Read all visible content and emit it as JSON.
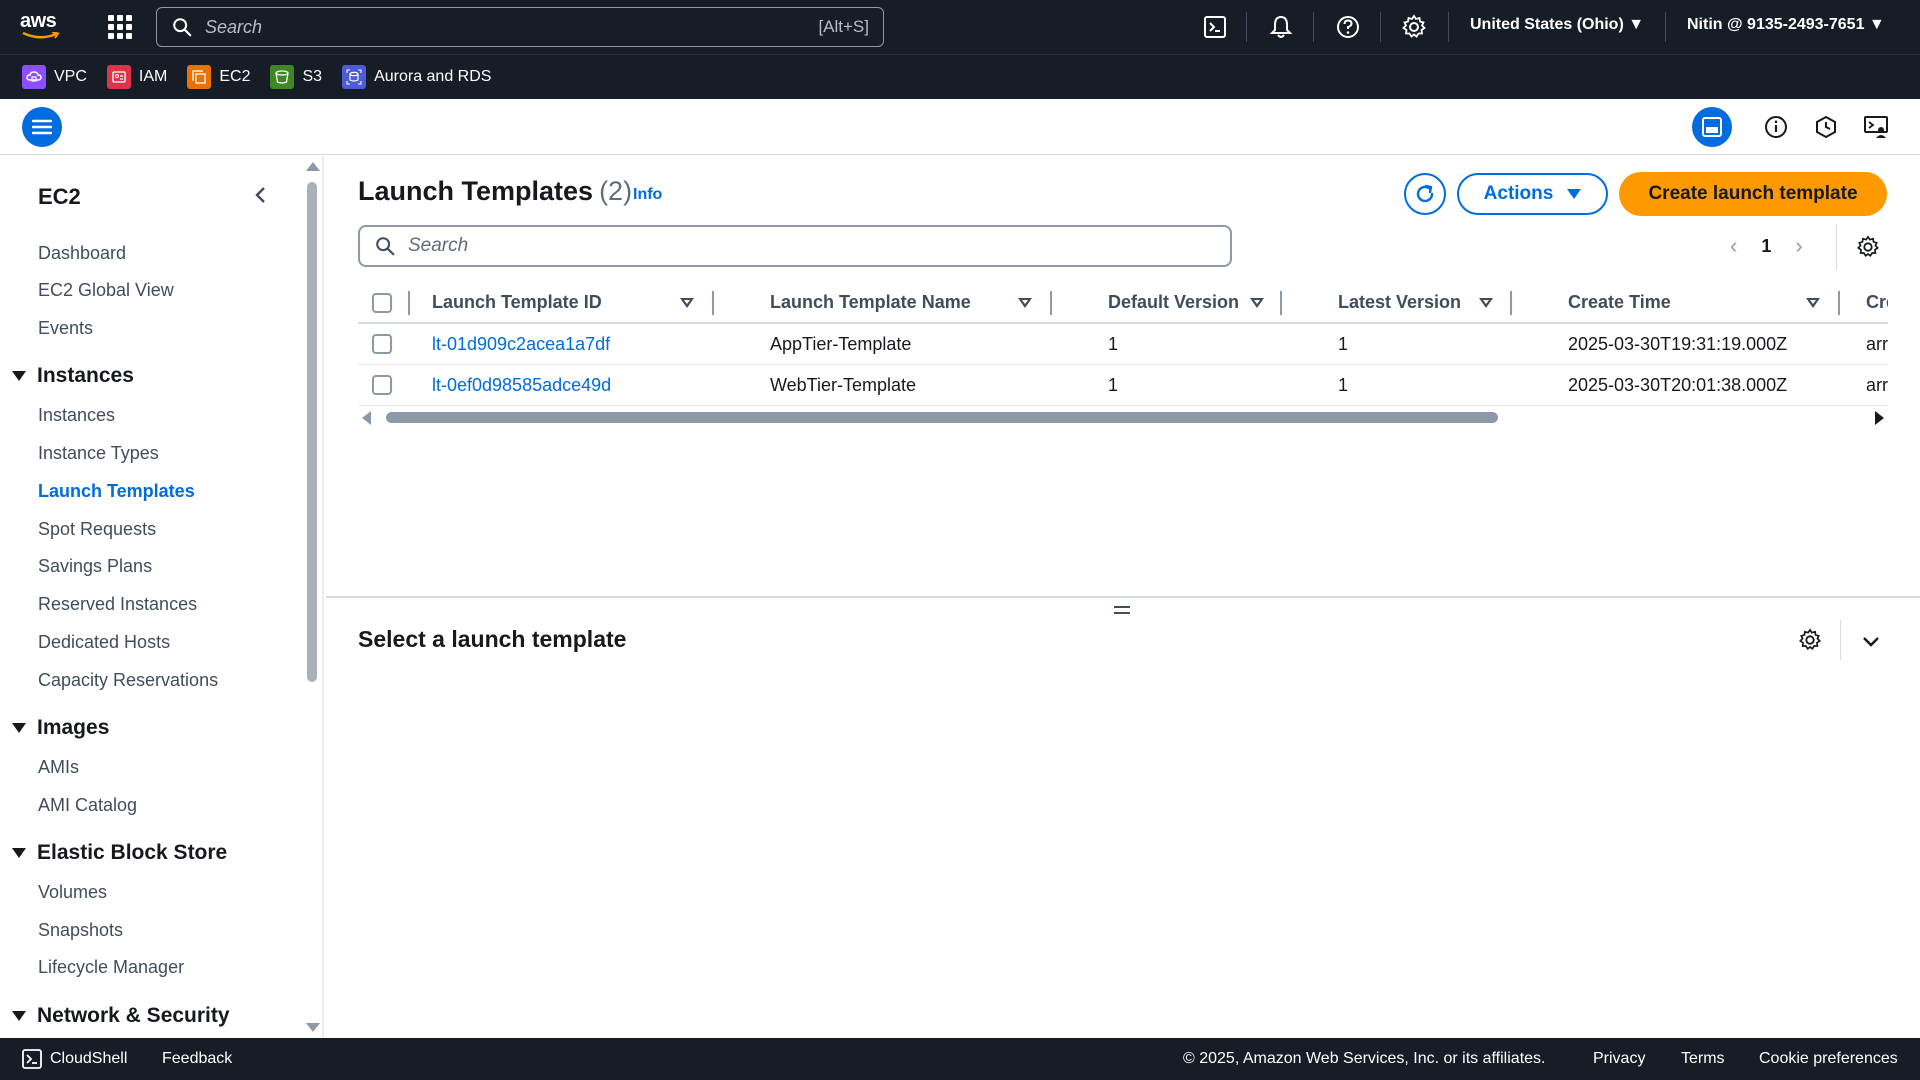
{
  "topnav": {
    "logo_text": "aws",
    "search_placeholder": "Search",
    "search_shortcut": "[Alt+S]",
    "region": "United States (Ohio) ▼",
    "account": "Nitin @ 9135-2493-7651 ▼"
  },
  "favorites": [
    {
      "label": "VPC",
      "color": "#8c4fff"
    },
    {
      "label": "IAM",
      "color": "#dd344c"
    },
    {
      "label": "EC2",
      "color": "#ed7100"
    },
    {
      "label": "S3",
      "color": "#3f8624"
    },
    {
      "label": "Aurora and RDS",
      "color": "#4d5bd9"
    }
  ],
  "sidebar": {
    "title": "EC2",
    "top_links": [
      "Dashboard",
      "EC2 Global View",
      "Events"
    ],
    "groups": [
      {
        "label": "Instances",
        "items": [
          "Instances",
          "Instance Types",
          "Launch Templates",
          "Spot Requests",
          "Savings Plans",
          "Reserved Instances",
          "Dedicated Hosts",
          "Capacity Reservations"
        ]
      },
      {
        "label": "Images",
        "items": [
          "AMIs",
          "AMI Catalog"
        ]
      },
      {
        "label": "Elastic Block Store",
        "items": [
          "Volumes",
          "Snapshots",
          "Lifecycle Manager"
        ]
      },
      {
        "label": "Network & Security",
        "items": []
      }
    ],
    "active_item": "Launch Templates"
  },
  "main": {
    "title": "Launch Templates",
    "count": "(2)",
    "info_label": "Info",
    "actions_label": "Actions",
    "create_label": "Create launch template",
    "search_placeholder": "Search",
    "page_number": "1",
    "columns": [
      "Launch Template ID",
      "Launch Template Name",
      "Default Version",
      "Latest Version",
      "Create Time",
      "Cre"
    ],
    "rows": [
      {
        "id": "lt-01d909c2acea1a7df",
        "name": "AppTier-Template",
        "default_version": "1",
        "latest_version": "1",
        "create_time": "2025-03-30T19:31:19.000Z",
        "created_by": "arr"
      },
      {
        "id": "lt-0ef0d98585adce49d",
        "name": "WebTier-Template",
        "default_version": "1",
        "latest_version": "1",
        "create_time": "2025-03-30T20:01:38.000Z",
        "created_by": "arr"
      }
    ]
  },
  "split_panel": {
    "title": "Select a launch template"
  },
  "footer": {
    "cloudshell": "CloudShell",
    "feedback": "Feedback",
    "copyright": "© 2025, Amazon Web Services, Inc. or its affiliates.",
    "privacy": "Privacy",
    "terms": "Terms",
    "cookie": "Cookie preferences"
  },
  "colors": {
    "nav_bg": "#161d26",
    "accent": "#006ce0",
    "primary_button": "#ff9900"
  }
}
